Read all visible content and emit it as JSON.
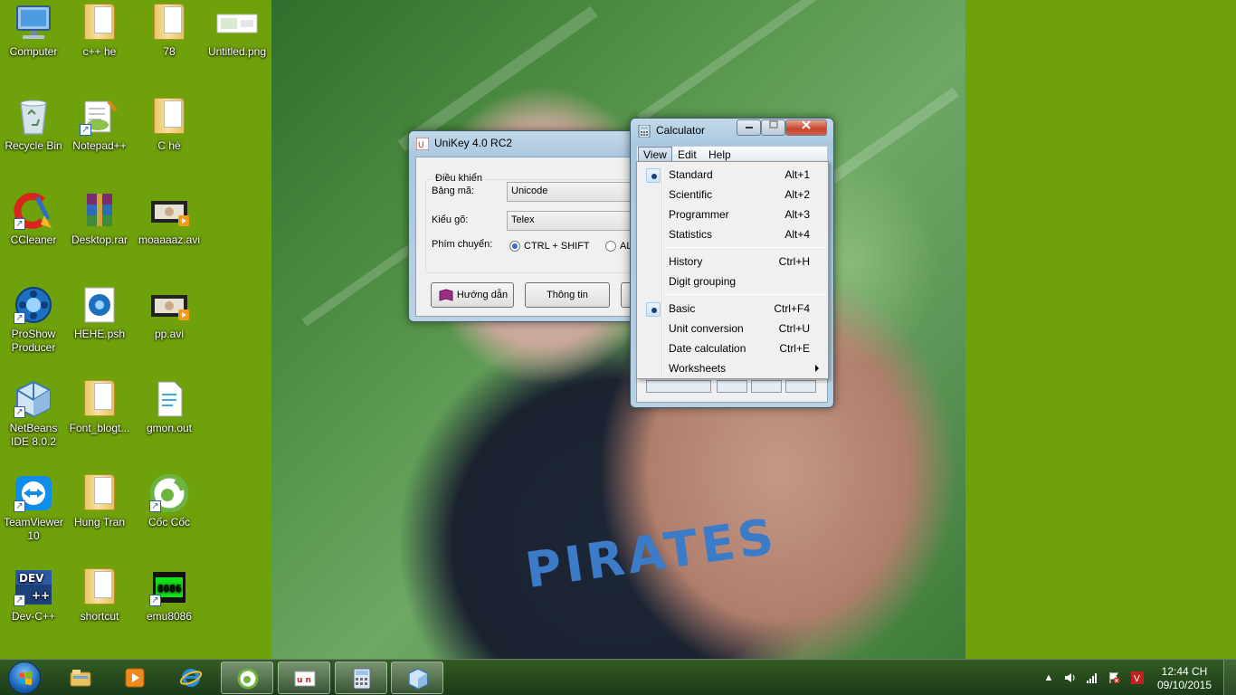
{
  "desktop": {
    "icons": [
      {
        "label": "Computer",
        "icon": "computer-icon"
      },
      {
        "label": "c++ he",
        "icon": "folder-icon"
      },
      {
        "label": "78",
        "icon": "folder-icon"
      },
      {
        "label": "Untitled.png",
        "icon": "image-file-icon"
      },
      {
        "label": "Recycle Bin",
        "icon": "recycle-bin-icon"
      },
      {
        "label": "Notepad++",
        "icon": "notepadpp-icon"
      },
      {
        "label": "C hè",
        "icon": "folder-icon"
      },
      {
        "label": "CCleaner",
        "icon": "ccleaner-icon"
      },
      {
        "label": "Desktop.rar",
        "icon": "winrar-archive-icon"
      },
      {
        "label": "moaaaaz.avi",
        "icon": "video-file-icon"
      },
      {
        "label": "ProShow Producer",
        "icon": "proshow-icon"
      },
      {
        "label": "HEHE.psh",
        "icon": "proshow-file-icon"
      },
      {
        "label": "pp.avi",
        "icon": "video-file-icon"
      },
      {
        "label": "NetBeans IDE 8.0.2",
        "icon": "netbeans-icon"
      },
      {
        "label": "Font_blogt...",
        "icon": "folder-icon"
      },
      {
        "label": "gmon.out",
        "icon": "text-file-icon"
      },
      {
        "label": "TeamViewer 10",
        "icon": "teamviewer-icon"
      },
      {
        "label": "Hung Tran",
        "icon": "folder-icon"
      },
      {
        "label": "Cốc Cốc",
        "icon": "coccoc-icon"
      },
      {
        "label": "Dev-C++",
        "icon": "devcpp-icon"
      },
      {
        "label": "shortcut",
        "icon": "folder-icon"
      },
      {
        "label": "emu8086",
        "icon": "emu8086-icon"
      }
    ]
  },
  "unikey": {
    "title": "UniKey 4.0 RC2",
    "group_title": "Điều khiển",
    "charset_label": "Bảng mã:",
    "charset_value": "Unicode",
    "input_label": "Kiểu gõ:",
    "input_value": "Telex",
    "switch_label": "Phím chuyển:",
    "switch_option_1": "CTRL + SHIFT",
    "switch_option_2": "AL",
    "help_button": "Hướng dẫn",
    "info_button": "Thông tin"
  },
  "calculator": {
    "title": "Calculator",
    "menus": [
      "View",
      "Edit",
      "Help"
    ],
    "view_menu": [
      {
        "label": "Standard",
        "shortcut": "Alt+1",
        "checked": true
      },
      {
        "label": "Scientific",
        "shortcut": "Alt+2",
        "checked": false
      },
      {
        "label": "Programmer",
        "shortcut": "Alt+3",
        "checked": false
      },
      {
        "label": "Statistics",
        "shortcut": "Alt+4",
        "checked": false
      },
      {
        "label": "History",
        "shortcut": "Ctrl+H",
        "checked": false
      },
      {
        "label": "Digit grouping",
        "shortcut": "",
        "checked": false
      },
      {
        "label": "Basic",
        "shortcut": "Ctrl+F4",
        "checked": true
      },
      {
        "label": "Unit conversion",
        "shortcut": "Ctrl+U",
        "checked": false
      },
      {
        "label": "Date calculation",
        "shortcut": "Ctrl+E",
        "checked": false
      },
      {
        "label": "Worksheets",
        "shortcut": "",
        "checked": false
      }
    ]
  },
  "taskbar": {
    "pinned": [
      "windows-explorer-icon",
      "media-player-icon",
      "internet-explorer-icon",
      "coccoc-icon",
      "unikey-icon",
      "calculator-icon",
      "netbeans-icon"
    ],
    "clock_time": "12:44 CH",
    "clock_date": "09/10/2015"
  },
  "colors": {
    "desktop_bg": "#6fa10a",
    "radio_selected": "#2c6fc9"
  }
}
